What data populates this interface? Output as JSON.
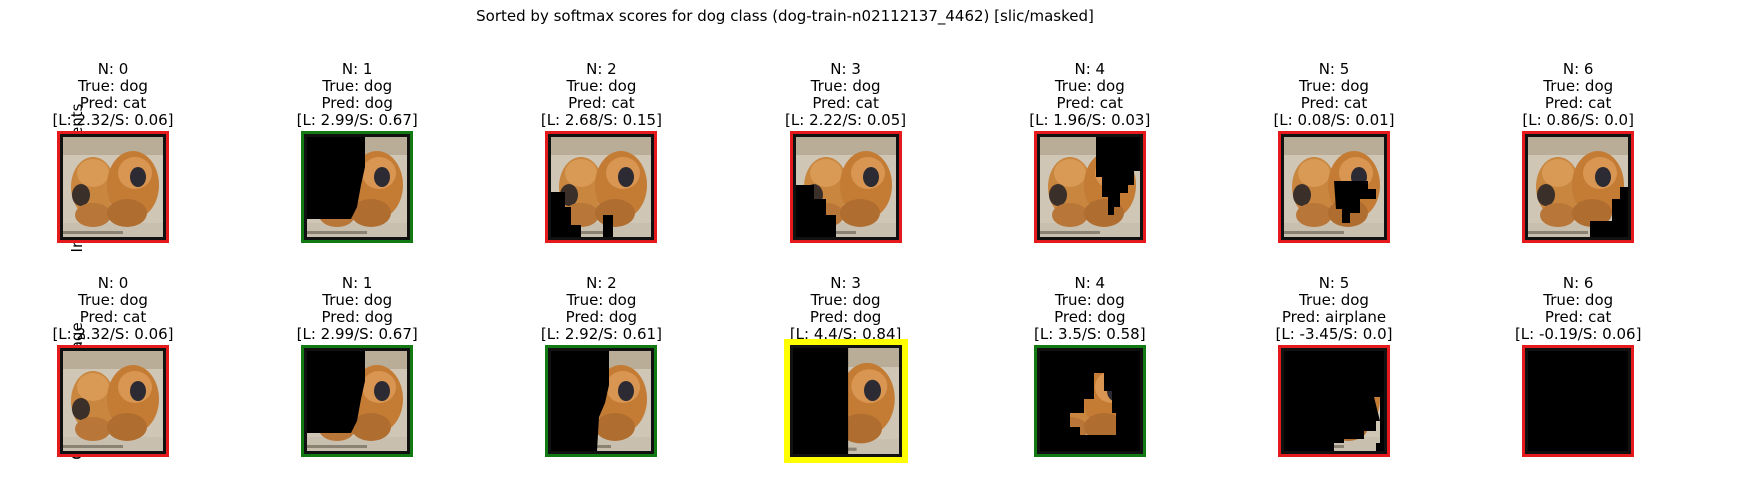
{
  "figure": {
    "suptitle": "Sorted by softmax scores for dog class (dog-train-n02112137_4462) [slic/masked]"
  },
  "colors": {
    "wrong": "#e41a1c",
    "correct": "#137a13",
    "best": "#ffff00"
  },
  "rows": [
    {
      "label": "Indvidual Segments",
      "panels": [
        {
          "n": "N: 0",
          "true": "True: dog",
          "pred": "Pred: cat",
          "scores": "[L: 2.32/S: 0.06]",
          "border": "wrong",
          "mask": "none"
        },
        {
          "n": "N: 1",
          "true": "True: dog",
          "pred": "Pred: dog",
          "scores": "[L: 2.99/S: 0.67]",
          "border": "correct",
          "mask": "left"
        },
        {
          "n": "N: 2",
          "true": "True: dog",
          "pred": "Pred: cat",
          "scores": "[L: 2.68/S: 0.15]",
          "border": "wrong",
          "mask": "left-bottom-small"
        },
        {
          "n": "N: 3",
          "true": "True: dog",
          "pred": "Pred: cat",
          "scores": "[L: 2.22/S: 0.05]",
          "border": "wrong",
          "mask": "bottom-left"
        },
        {
          "n": "N: 4",
          "true": "True: dog",
          "pred": "Pred: cat",
          "scores": "[L: 1.96/S: 0.03]",
          "border": "wrong",
          "mask": "top-right"
        },
        {
          "n": "N: 5",
          "true": "True: dog",
          "pred": "Pred: cat",
          "scores": "[L: 0.08/S: 0.01]",
          "border": "wrong",
          "mask": "center"
        },
        {
          "n": "N: 6",
          "true": "True: dog",
          "pred": "Pred: cat",
          "scores": "[L: 0.86/S: 0.0]",
          "border": "wrong",
          "mask": "bottom-right"
        }
      ]
    },
    {
      "label": "Cumulative Image",
      "panels": [
        {
          "n": "N: 0",
          "true": "True: dog",
          "pred": "Pred: cat",
          "scores": "[L: 2.32/S: 0.06]",
          "border": "wrong",
          "mask": "none"
        },
        {
          "n": "N: 1",
          "true": "True: dog",
          "pred": "Pred: dog",
          "scores": "[L: 2.99/S: 0.67]",
          "border": "correct",
          "mask": "left"
        },
        {
          "n": "N: 2",
          "true": "True: dog",
          "pred": "Pred: dog",
          "scores": "[L: 2.92/S: 0.61]",
          "border": "correct",
          "mask": "left-more"
        },
        {
          "n": "N: 3",
          "true": "True: dog",
          "pred": "Pred: dog",
          "scores": "[L: 4.4/S: 0.84]",
          "border": "best",
          "mask": "half"
        },
        {
          "n": "N: 4",
          "true": "True: dog",
          "pred": "Pred: dog",
          "scores": "[L: 3.5/S: 0.58]",
          "border": "correct",
          "mask": "remnant-mid"
        },
        {
          "n": "N: 5",
          "true": "True: dog",
          "pred": "Pred: airplane",
          "scores": "[L: -3.45/S: 0.0]",
          "border": "wrong",
          "mask": "remnant-low"
        },
        {
          "n": "N: 6",
          "true": "True: dog",
          "pred": "Pred: cat",
          "scores": "[L: -0.19/S: 0.06]",
          "border": "wrong",
          "mask": "all"
        }
      ]
    }
  ]
}
